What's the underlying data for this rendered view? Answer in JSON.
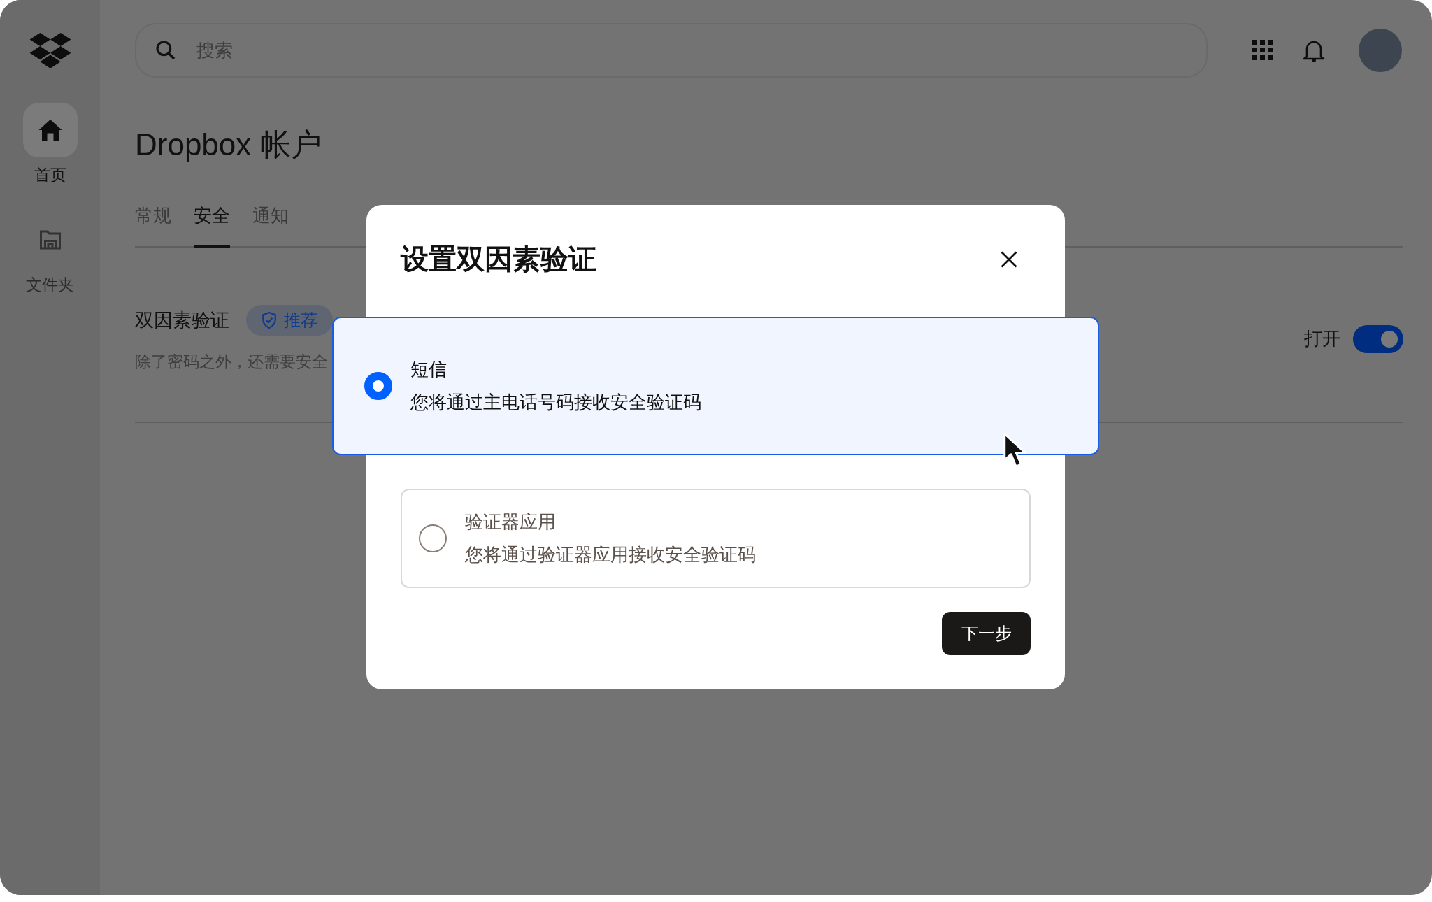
{
  "sidebar": {
    "items": [
      {
        "label": "首页",
        "kind": "home",
        "selected": true
      },
      {
        "label": "文件夹",
        "kind": "folder",
        "selected": false
      }
    ]
  },
  "search": {
    "placeholder": "搜索"
  },
  "page": {
    "title": "Dropbox 帐户"
  },
  "tabs": [
    {
      "label": "常规",
      "selected": false
    },
    {
      "label": "安全",
      "selected": true
    },
    {
      "label": "通知",
      "selected": false
    }
  ],
  "setting": {
    "title": "双因素验证",
    "badge": "推荐",
    "description": "除了密码之外，还需要安全",
    "toggle_label": "打开",
    "on": true
  },
  "dialog": {
    "title": "设置双因素验证",
    "options": [
      {
        "title": "短信",
        "description": "您将通过主电话号码接收安全验证码",
        "selected": true
      },
      {
        "title": "验证器应用",
        "description": "您将通过验证器应用接收安全验证码",
        "selected": false
      }
    ],
    "next_button": "下一步"
  }
}
